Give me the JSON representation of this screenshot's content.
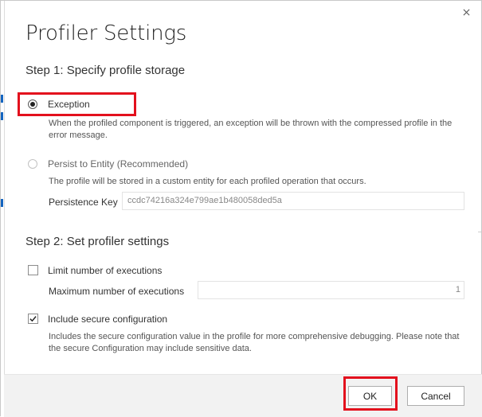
{
  "dialog": {
    "title": "Profiler Settings"
  },
  "step1": {
    "heading": "Step 1: Specify profile storage",
    "options": [
      {
        "label": "Exception",
        "selected": true,
        "description": "When the profiled component is triggered, an exception will be thrown with the compressed profile in the error message."
      },
      {
        "label": "Persist to Entity (Recommended)",
        "selected": false,
        "description": "The profile will be stored in a custom entity for each profiled operation that occurs."
      }
    ],
    "persistence_key_label": "Persistence Key",
    "persistence_key_value": "ccdc74216a324e799ae1b480058ded5a"
  },
  "step2": {
    "heading": "Step 2: Set profiler settings",
    "limit_label": "Limit number of executions",
    "limit_checked": false,
    "max_label": "Maximum number of executions",
    "max_value": "1",
    "secure_label": "Include secure configuration",
    "secure_checked": true,
    "secure_description": "Includes the secure configuration value in the profile for more comprehensive debugging. Please note that the secure Configuration may include sensitive data."
  },
  "footer": {
    "ok_label": "OK",
    "cancel_label": "Cancel"
  },
  "icons": {
    "close": "close-icon",
    "check": "checkmark-icon"
  },
  "colors": {
    "highlight": "#e3101d",
    "footer_bg": "#f2f2f2"
  }
}
